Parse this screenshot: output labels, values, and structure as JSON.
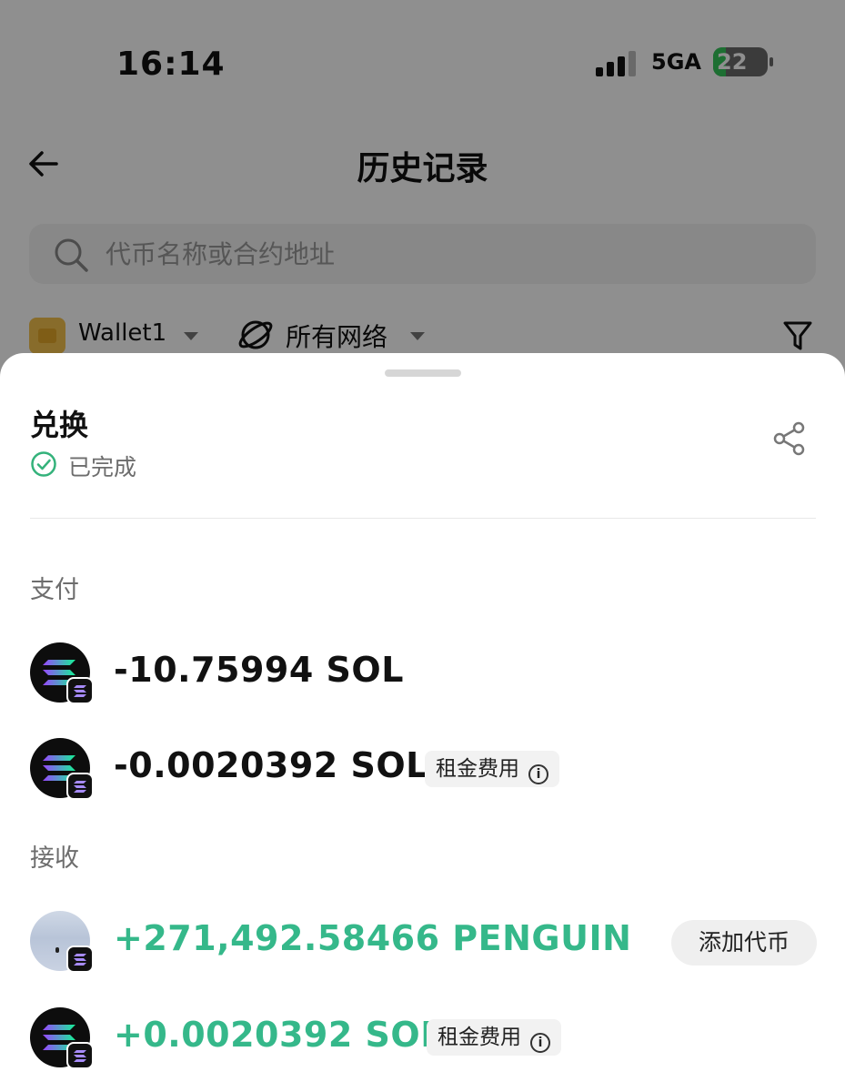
{
  "status_bar": {
    "time": "16:14",
    "network": "5GA",
    "battery": "22"
  },
  "header": {
    "title": "历史记录"
  },
  "search": {
    "placeholder": "代币名称或合约地址"
  },
  "filters": {
    "wallet": "Wallet1",
    "network": "所有网络"
  },
  "sheet": {
    "title": "兑换",
    "status": "已完成",
    "pay_label": "支付",
    "receive_label": "接收",
    "pay_items": [
      {
        "amount": "-10.75994 SOL",
        "tag": ""
      },
      {
        "amount": "-0.0020392 SOL",
        "tag": "租金费用"
      }
    ],
    "receive_items": [
      {
        "amount": "+271,492.58466 PENGUIN",
        "action": "添加代币"
      },
      {
        "amount": "+0.0020392 SOL",
        "tag": "租金费用"
      }
    ]
  },
  "colors": {
    "positive": "#35b88a",
    "negative": "#111111",
    "status_ok": "#34b27b"
  },
  "icons": [
    "back-arrow-icon",
    "search-icon",
    "wallet-icon",
    "globe-icon",
    "filter-icon",
    "check-circle-icon",
    "share-icon",
    "solana-icon",
    "info-icon"
  ]
}
